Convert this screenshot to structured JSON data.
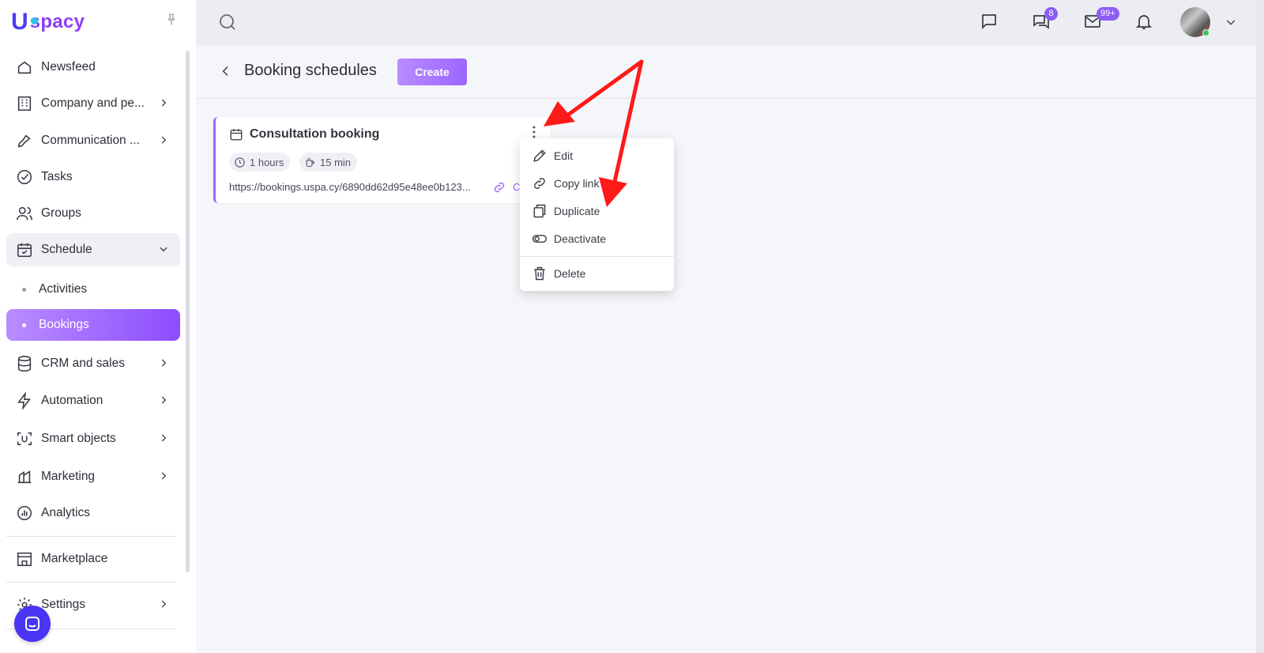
{
  "app": {
    "logo_text": "spacy",
    "logo_mark": "U"
  },
  "sidebar": {
    "items": [
      {
        "label": "Newsfeed",
        "icon": "home-icon"
      },
      {
        "label": "Company and pe...",
        "icon": "building-icon"
      },
      {
        "label": "Communication ...",
        "icon": "communication-icon"
      },
      {
        "label": "Tasks",
        "icon": "check-circle-icon"
      },
      {
        "label": "Groups",
        "icon": "users-icon"
      },
      {
        "label": "Schedule",
        "icon": "calendar-icon"
      },
      {
        "label": "CRM and sales",
        "icon": "database-icon"
      },
      {
        "label": "Automation",
        "icon": "lightning-icon"
      },
      {
        "label": "Smart objects",
        "icon": "smart-objects-icon"
      },
      {
        "label": "Marketing",
        "icon": "marketing-icon"
      },
      {
        "label": "Analytics",
        "icon": "chart-icon"
      },
      {
        "label": "Marketplace",
        "icon": "store-icon"
      },
      {
        "label": "Settings",
        "icon": "gear-icon"
      }
    ],
    "schedule_sub": [
      {
        "label": "Activities"
      },
      {
        "label": "Bookings"
      }
    ]
  },
  "topbar": {
    "chat_badge": "8",
    "mail_badge": "99+"
  },
  "page": {
    "title": "Booking schedules",
    "create_label": "Create"
  },
  "card": {
    "title": "Consultation booking",
    "duration": "1 hours",
    "break": "15 min",
    "url": "https://bookings.uspa.cy/6890dd62d95e48ee0b123...",
    "copy_text": "C"
  },
  "menu": {
    "items": [
      {
        "label": "Edit",
        "icon": "pencil-icon"
      },
      {
        "label": "Copy link",
        "icon": "link-icon"
      },
      {
        "label": "Duplicate",
        "icon": "duplicate-icon"
      },
      {
        "label": "Deactivate",
        "icon": "toggle-icon"
      },
      {
        "label": "Delete",
        "icon": "trash-icon"
      }
    ]
  },
  "colors": {
    "accent": "#9b66ff",
    "brand": "#4c3df0",
    "annotation": "#ff1a1a"
  }
}
